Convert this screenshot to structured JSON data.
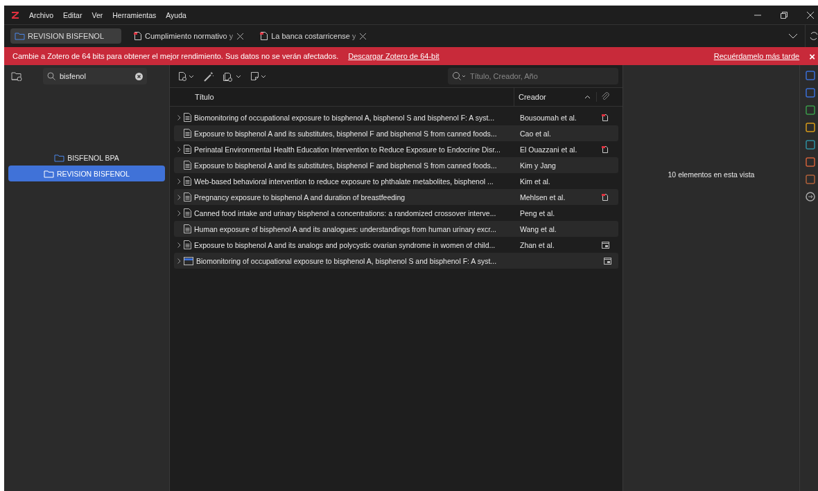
{
  "menu": [
    "Archivo",
    "Editar",
    "Ver",
    "Herramientas",
    "Ayuda"
  ],
  "tabs": [
    {
      "label": "REVISION BISFENOL",
      "kind": "library",
      "selected": true
    },
    {
      "label": "Cumplimiento normativo y",
      "kind": "pdf",
      "selected": false
    },
    {
      "label": "La banca costarricense y",
      "kind": "pdf",
      "selected": false
    }
  ],
  "banner": {
    "message": "Cambie a Zotero de 64 bits para obtener el mejor rendimiento. Sus datos no se verán afectados.",
    "link": "Descargar Zotero de 64-bit",
    "later": "Recuérdamelo más tarde",
    "close": "×"
  },
  "collection_search": {
    "value": "bisfenol"
  },
  "collections": [
    {
      "label": "BISFENOL BPA",
      "selected": false
    },
    {
      "label": "REVISION BISFENOL",
      "selected": true
    }
  ],
  "item_search": {
    "placeholder": "Título, Creador, Año"
  },
  "table": {
    "columns": [
      "Título",
      "Creador"
    ],
    "rows": [
      {
        "title": "Biomonitoring of occupational exposure to bisphenol A, bisphenol S and bisphenol F: A syst...",
        "creator": "Bousoumah et al.",
        "expandable": true,
        "kind": "document",
        "pdf": true,
        "snapshot": false
      },
      {
        "title": "Exposure to bisphenol A and its substitutes, bisphenol F and bisphenol S from canned foods...",
        "creator": "Cao et al.",
        "expandable": false,
        "kind": "document",
        "pdf": false,
        "snapshot": false
      },
      {
        "title": "Perinatal Environmental Health Education Intervention to Reduce Exposure to Endocrine Disr...",
        "creator": "El Ouazzani et al.",
        "expandable": true,
        "kind": "document",
        "pdf": true,
        "snapshot": false
      },
      {
        "title": "Exposure to bisphenol A and its substitutes, bisphenol F and bisphenol S from canned foods...",
        "creator": "Kim y Jang",
        "expandable": false,
        "kind": "document",
        "pdf": false,
        "snapshot": false
      },
      {
        "title": "Web-based behavioral intervention to reduce exposure to phthalate metabolites, bisphenol ...",
        "creator": "Kim et al.",
        "expandable": true,
        "kind": "document",
        "pdf": false,
        "snapshot": false
      },
      {
        "title": "Pregnancy exposure to bisphenol A and duration of breastfeeding",
        "creator": "Mehlsen et al.",
        "expandable": true,
        "kind": "document",
        "pdf": true,
        "snapshot": false
      },
      {
        "title": "Canned food intake and urinary bisphenol a concentrations: a randomized crossover interve...",
        "creator": "Peng et al.",
        "expandable": true,
        "kind": "document",
        "pdf": false,
        "snapshot": false
      },
      {
        "title": "Human exposure of bisphenol A and its analogues: understandings from human urinary excr...",
        "creator": "Wang et al.",
        "expandable": false,
        "kind": "document",
        "pdf": false,
        "snapshot": false
      },
      {
        "title": "Exposure to bisphenol A and its analogs and polycystic ovarian syndrome in women of child...",
        "creator": "Zhan et al.",
        "expandable": true,
        "kind": "document",
        "pdf": false,
        "snapshot": true
      },
      {
        "title": "Biomonitoring of occupational exposure to bisphenol A, bisphenol S and bisphenol F: A syst...",
        "creator": "",
        "expandable": true,
        "kind": "webpage",
        "pdf": false,
        "snapshot": true
      }
    ]
  },
  "item_pane": {
    "message": "10 elementos en esta vista"
  }
}
